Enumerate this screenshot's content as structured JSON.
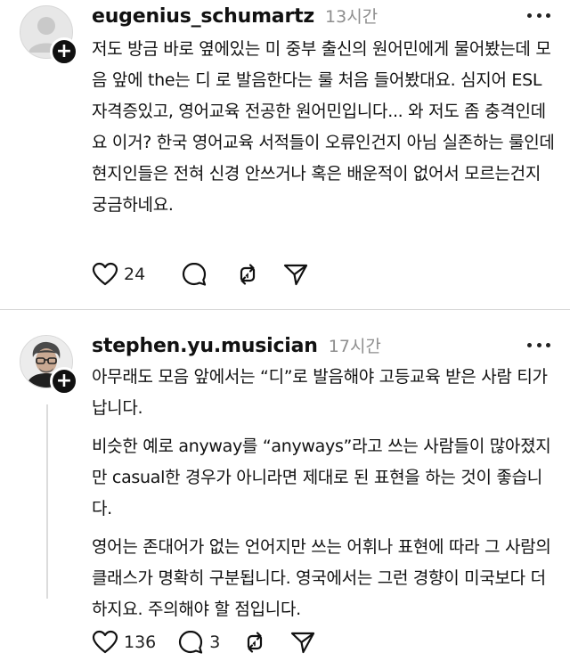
{
  "posts": [
    {
      "username": "eugenius_schumartz",
      "time": "13시간",
      "paragraphs": [
        "저도 방금 바로 옆에있는 미 중부 출신의 원어민에게 물어봤는데 모음 앞에 the는 디 로 발음한다는 룰 처음 들어봤대요. 심지어 ESL 자격증있고, 영어교육 전공한 원어민입니다... 와 저도 좀 충격인데요 이거? 한국 영어교육 서적들이 오류인건지 아님 실존하는 룰인데 현지인들은 전혀 신경 안쓰거나 혹은 배운적이 없어서 모르는건지 궁금하네요."
      ],
      "likes": "24",
      "replies": ""
    },
    {
      "username": "stephen.yu.musician",
      "time": "17시간",
      "paragraphs": [
        "아무래도 모음 앞에서는 “디”로 발음해야 고등교육 받은 사람 티가 납니다.",
        "비슷한 예로 anyway를 “anyways”라고 쓰는 사람들이 많아졌지만 casual한 경우가 아니라면 제대로 된 표현을 하는 것이 좋습니다.",
        "영어는 존대어가 없는 언어지만 쓰는 어휘나 표현에 따라 그 사람의 클래스가 명확히 구분됩니다. 영국에서는 그런 경향이 미국보다 더 하지요. 주의해야 할 점입니다."
      ],
      "likes": "136",
      "replies": "3"
    }
  ],
  "icons": {
    "like": "heart-icon",
    "reply": "comment-icon",
    "repost": "repost-icon",
    "share": "send-icon",
    "follow": "plus-icon",
    "more": "more-icon"
  }
}
